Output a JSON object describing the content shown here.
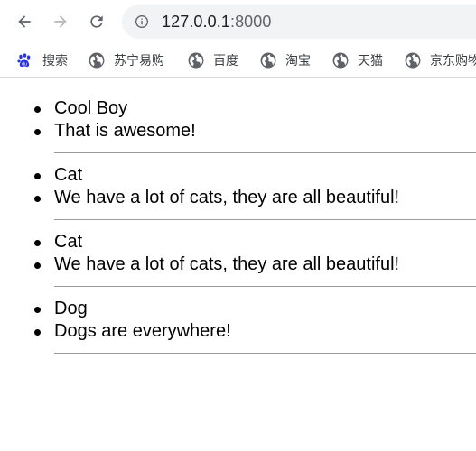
{
  "browser": {
    "url_host": "127.0.0.1",
    "url_port": ":8000",
    "bookmarks": [
      {
        "label": "搜索",
        "icon": "baidu-paw-icon"
      },
      {
        "label": "苏宁易购",
        "icon": "globe-icon"
      },
      {
        "label": "百度",
        "icon": "globe-icon"
      },
      {
        "label": "淘宝",
        "icon": "globe-icon"
      },
      {
        "label": "天猫",
        "icon": "globe-icon"
      },
      {
        "label": "京东购物",
        "icon": "globe-icon"
      }
    ]
  },
  "posts": [
    {
      "title": "Cool Boy",
      "content": "That is awesome!"
    },
    {
      "title": "Cat",
      "content": "We have a lot of cats, they are all beautiful!"
    },
    {
      "title": "Cat",
      "content": "We have a lot of cats, they are all beautiful!"
    },
    {
      "title": "Dog",
      "content": "Dogs are everywhere!"
    }
  ],
  "colors": {
    "omnibox_bg": "#f1f3f4",
    "text": "#000000",
    "chrome_icon": "#5f6368"
  }
}
